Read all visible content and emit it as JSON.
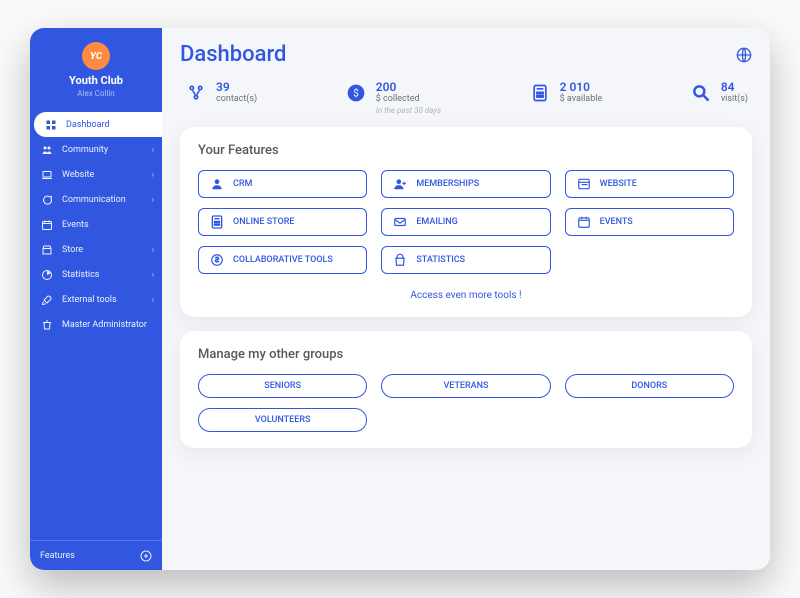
{
  "brand": {
    "logo_text": "YC",
    "name": "Youth Club",
    "user": "Alex Collin"
  },
  "sidebar": {
    "items": [
      {
        "label": "Dashboard",
        "icon": "dashboard-icon",
        "chevron": false,
        "active": true
      },
      {
        "label": "Community",
        "icon": "community-icon",
        "chevron": true
      },
      {
        "label": "Website",
        "icon": "laptop-icon",
        "chevron": true
      },
      {
        "label": "Communication",
        "icon": "chat-icon",
        "chevron": true
      },
      {
        "label": "Events",
        "icon": "calendar-icon",
        "chevron": false
      },
      {
        "label": "Store",
        "icon": "store-icon",
        "chevron": true
      },
      {
        "label": "Statistics",
        "icon": "stats-icon",
        "chevron": true
      },
      {
        "label": "External tools",
        "icon": "rocket-icon",
        "chevron": true
      },
      {
        "label": "Master Administrator",
        "icon": "trash-icon",
        "chevron": false
      }
    ],
    "footer": {
      "label": "Features",
      "icon": "plus-circle-icon"
    }
  },
  "header": {
    "title": "Dashboard"
  },
  "stats": [
    {
      "icon": "contacts-icon",
      "value": "39",
      "label": "contact(s)"
    },
    {
      "icon": "dollar-icon",
      "value": "200",
      "label": "$ collected",
      "sub": "In the past 30 days"
    },
    {
      "icon": "calculator-icon",
      "value": "2 010",
      "label": "$ available"
    },
    {
      "icon": "search-icon",
      "value": "84",
      "label": "visit(s)"
    }
  ],
  "features": {
    "title": "Your Features",
    "items": [
      {
        "label": "CRM",
        "icon": "person-icon"
      },
      {
        "label": "MEMBERSHIPS",
        "icon": "person-plus-icon"
      },
      {
        "label": "WEBSITE",
        "icon": "browser-icon"
      },
      {
        "label": "ONLINE STORE",
        "icon": "calculator-icon"
      },
      {
        "label": "EMAILING",
        "icon": "mail-icon"
      },
      {
        "label": "EVENTS",
        "icon": "calendar2-icon"
      },
      {
        "label": "COLLABORATIVE TOOLS",
        "icon": "dollar2-icon"
      },
      {
        "label": "STATISTICS",
        "icon": "bag-icon"
      }
    ],
    "more": "Access even more tools !"
  },
  "groups": {
    "title": "Manage my other groups",
    "items": [
      {
        "label": "SENIORS"
      },
      {
        "label": "VETERANS"
      },
      {
        "label": "DONORS"
      },
      {
        "label": "VOLUNTEERS"
      }
    ]
  },
  "colors": {
    "primary": "#3157E1",
    "accent": "#ff8a42"
  }
}
